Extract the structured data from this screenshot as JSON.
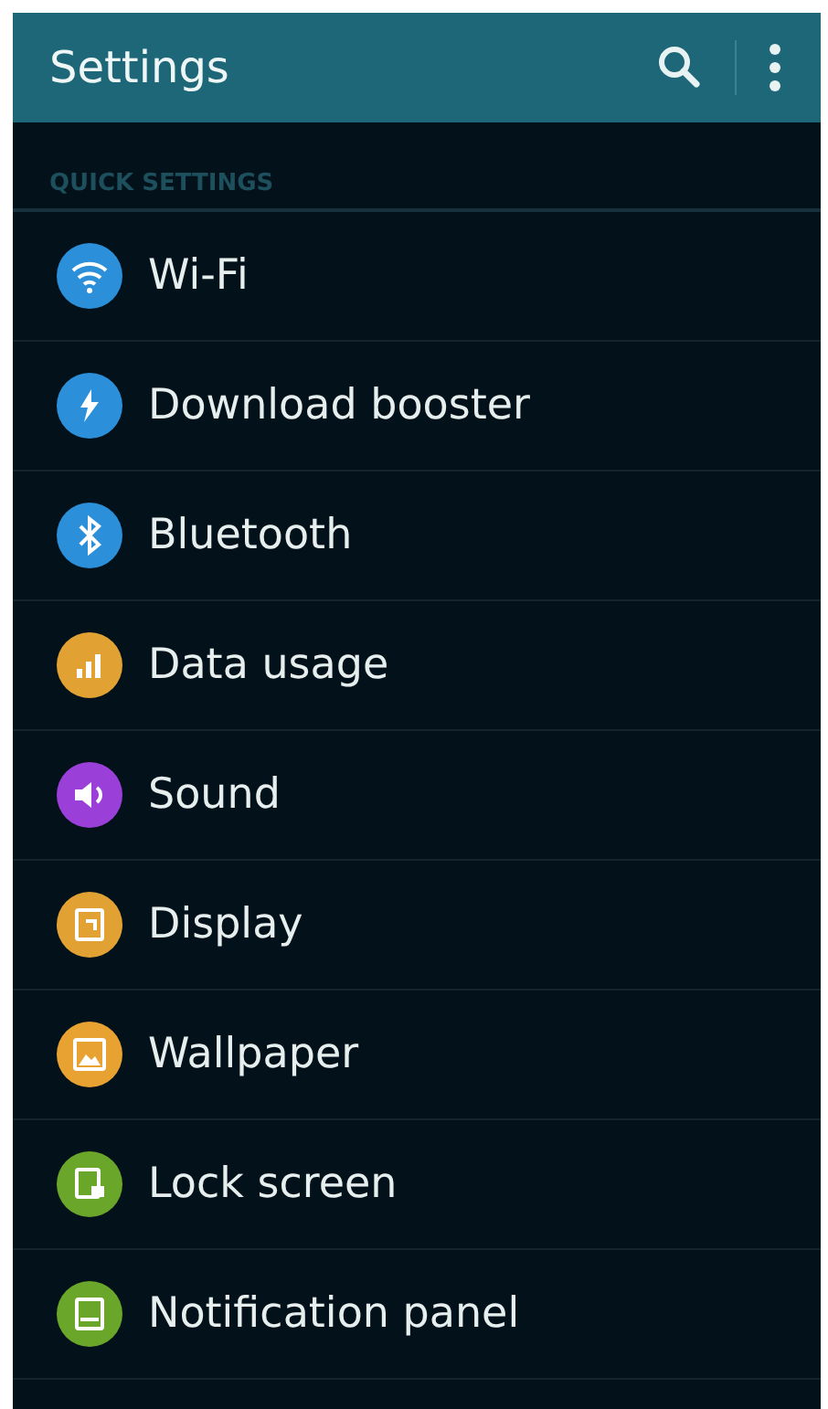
{
  "header": {
    "title": "Settings"
  },
  "section": {
    "title": "QUICK SETTINGS"
  },
  "items": [
    {
      "label": "Wi-Fi",
      "kind": "wifi",
      "color": "#2b8fd9"
    },
    {
      "label": "Download booster",
      "kind": "bolt",
      "color": "#2b8fd9"
    },
    {
      "label": "Bluetooth",
      "kind": "bluetooth",
      "color": "#2b8fd9"
    },
    {
      "label": "Data usage",
      "kind": "bars",
      "color": "#e2a233"
    },
    {
      "label": "Sound",
      "kind": "speaker",
      "color": "#9b3fd9"
    },
    {
      "label": "Display",
      "kind": "display",
      "color": "#e2a233"
    },
    {
      "label": "Wallpaper",
      "kind": "image",
      "color": "#e8a232"
    },
    {
      "label": "Lock screen",
      "kind": "lock",
      "color": "#6aa62a"
    },
    {
      "label": "Notification panel",
      "kind": "panel",
      "color": "#6aa62a"
    }
  ]
}
